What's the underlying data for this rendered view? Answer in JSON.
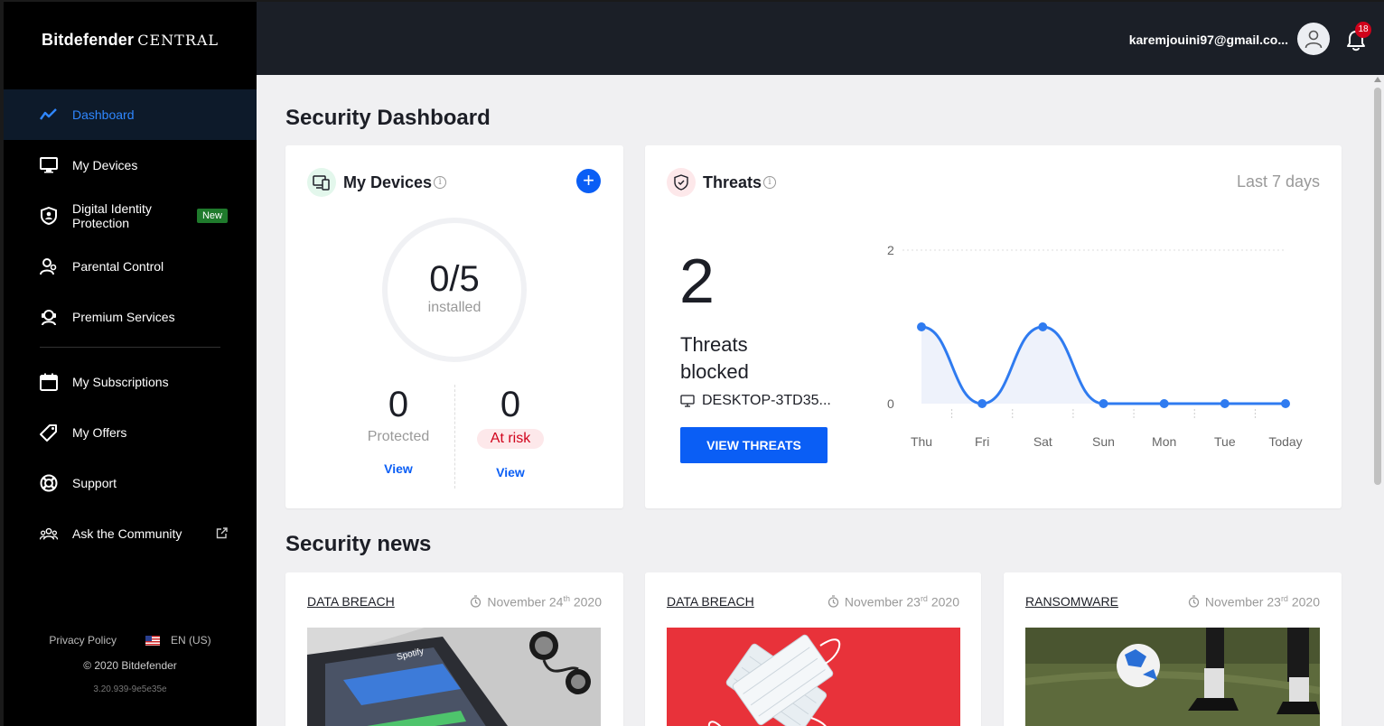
{
  "brand": {
    "name": "Bitdefender",
    "suffix": "CENTRAL"
  },
  "sidebar": {
    "items": [
      {
        "label": "Dashboard",
        "icon": "activity-icon",
        "active": true
      },
      {
        "label": "My Devices",
        "icon": "monitor-icon"
      },
      {
        "label": "Digital Identity Protection",
        "icon": "shield-user-icon",
        "badge": "New"
      },
      {
        "label": "Parental Control",
        "icon": "family-icon"
      },
      {
        "label": "Premium Services",
        "icon": "headset-icon"
      },
      {
        "label": "My Subscriptions",
        "icon": "calendar-icon"
      },
      {
        "label": "My Offers",
        "icon": "tag-icon"
      },
      {
        "label": "Support",
        "icon": "lifebuoy-icon"
      },
      {
        "label": "Ask the Community",
        "icon": "community-icon"
      }
    ],
    "footer": {
      "privacy": "Privacy Policy",
      "language": "EN (US)",
      "copyright": "© 2020 Bitdefender",
      "version": "3.20.939-9e5e35e"
    }
  },
  "topbar": {
    "email": "karemjouini97@gmail.co...",
    "notifications": "18"
  },
  "dashboard": {
    "title": "Security Dashboard",
    "devices": {
      "title": "My Devices",
      "installed": "0/5",
      "installed_label": "installed",
      "protected_count": "0",
      "protected_label": "Protected",
      "risk_count": "0",
      "risk_label": "At risk",
      "view": "View"
    },
    "threats": {
      "title": "Threats",
      "period": "Last 7 days",
      "count": "2",
      "label": "Threats blocked",
      "device": "DESKTOP-3TD35...",
      "button": "VIEW THREATS"
    }
  },
  "chart_data": {
    "type": "line",
    "categories": [
      "Thu",
      "Fri",
      "Sat",
      "Sun",
      "Mon",
      "Tue",
      "Today"
    ],
    "series": [
      {
        "values": [
          1,
          0,
          1,
          0,
          0,
          0,
          0
        ]
      }
    ],
    "yticks": [
      "0",
      "2"
    ],
    "ylim": [
      0,
      2
    ],
    "color": "#2f7bf0"
  },
  "news": {
    "title": "Security news",
    "items": [
      {
        "category": "DATA BREACH",
        "date_day": "November 24",
        "date_suffix": "th",
        "date_year": " 2020"
      },
      {
        "category": "DATA BREACH",
        "date_day": "November 23",
        "date_suffix": "rd",
        "date_year": " 2020"
      },
      {
        "category": "RANSOMWARE",
        "date_day": "November 23",
        "date_suffix": "rd",
        "date_year": " 2020"
      }
    ],
    "image_texts": [
      "Spotify"
    ]
  }
}
